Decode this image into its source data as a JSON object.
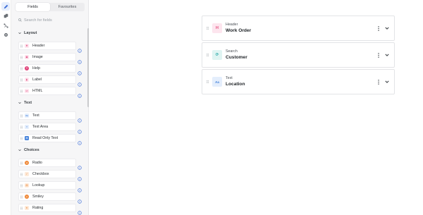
{
  "rail": {
    "items": [
      {
        "icon": "pencil-icon",
        "active": true
      },
      {
        "icon": "copy-icon",
        "active": false
      },
      {
        "icon": "workflow-icon",
        "active": false
      },
      {
        "icon": "gear-icon",
        "active": false
      }
    ]
  },
  "panel": {
    "tabs": [
      {
        "label": "Fields",
        "active": true
      },
      {
        "label": "Favourites",
        "active": false
      }
    ],
    "search_placeholder": "Search for fields",
    "sections": [
      {
        "title": "Layout",
        "items": [
          {
            "label": "Header",
            "icon": "header-icon",
            "glyph": "H",
            "color": "#e44f7d",
            "bg": "#fde5ee"
          },
          {
            "label": "Image",
            "icon": "image-icon",
            "glyph": "▣",
            "color": "#e0457b",
            "bg": "#fde5ee"
          },
          {
            "label": "Help",
            "icon": "help-icon",
            "glyph": "?",
            "color": "#e0457b",
            "bg": "#e0457b"
          },
          {
            "label": "Label",
            "icon": "label-icon",
            "glyph": "▮",
            "color": "#e0457b",
            "bg": "#fde5ee"
          },
          {
            "label": "HTML",
            "icon": "code-icon",
            "glyph": "</>",
            "color": "#e0457b",
            "bg": "#fde5ee"
          }
        ]
      },
      {
        "title": "Text",
        "items": [
          {
            "label": "Text",
            "icon": "text-icon",
            "glyph": "Aa",
            "color": "#3f7ed9",
            "bg": "#e4eefc"
          },
          {
            "label": "Text Area",
            "icon": "textarea-icon",
            "glyph": "≡",
            "color": "#3f7ed9",
            "bg": "#e4eefc"
          },
          {
            "label": "Read Only Text",
            "icon": "readonly-icon",
            "glyph": "▤",
            "color": "#ffffff",
            "bg": "#3f7ed9"
          }
        ]
      },
      {
        "title": "Choices",
        "items": [
          {
            "label": "Radio",
            "icon": "radio-icon",
            "glyph": "●",
            "color": "#ffffff",
            "bg": "#ef8a3a"
          },
          {
            "label": "Checkbox",
            "icon": "checkbox-icon",
            "glyph": "✓",
            "color": "#ef8a3a",
            "bg": "#fde9d8"
          },
          {
            "label": "Lookup",
            "icon": "lookup-icon",
            "glyph": "▤",
            "color": "#ef8a3a",
            "bg": "#fde9d8"
          },
          {
            "label": "Smiley",
            "icon": "smiley-icon",
            "glyph": "☺",
            "color": "#ffffff",
            "bg": "#ef8a3a"
          },
          {
            "label": "Rating",
            "icon": "star-icon",
            "glyph": "★",
            "color": "#ef8a3a",
            "bg": "#fde9d8"
          }
        ]
      }
    ]
  },
  "canvas": {
    "cards": [
      {
        "type": "Header",
        "name": "Work Order",
        "icon": "header-icon",
        "glyph": "H",
        "color": "#e44f7d",
        "bg": "#fde5ee"
      },
      {
        "type": "Search",
        "name": "Customer",
        "icon": "search-field-icon",
        "glyph": "⟳",
        "color": "#1aa3a3",
        "bg": "#dff4f2"
      },
      {
        "type": "Text",
        "name": "Location",
        "icon": "text-icon",
        "glyph": "Aa",
        "color": "#3f7ed9",
        "bg": "#e4eefc"
      }
    ]
  }
}
